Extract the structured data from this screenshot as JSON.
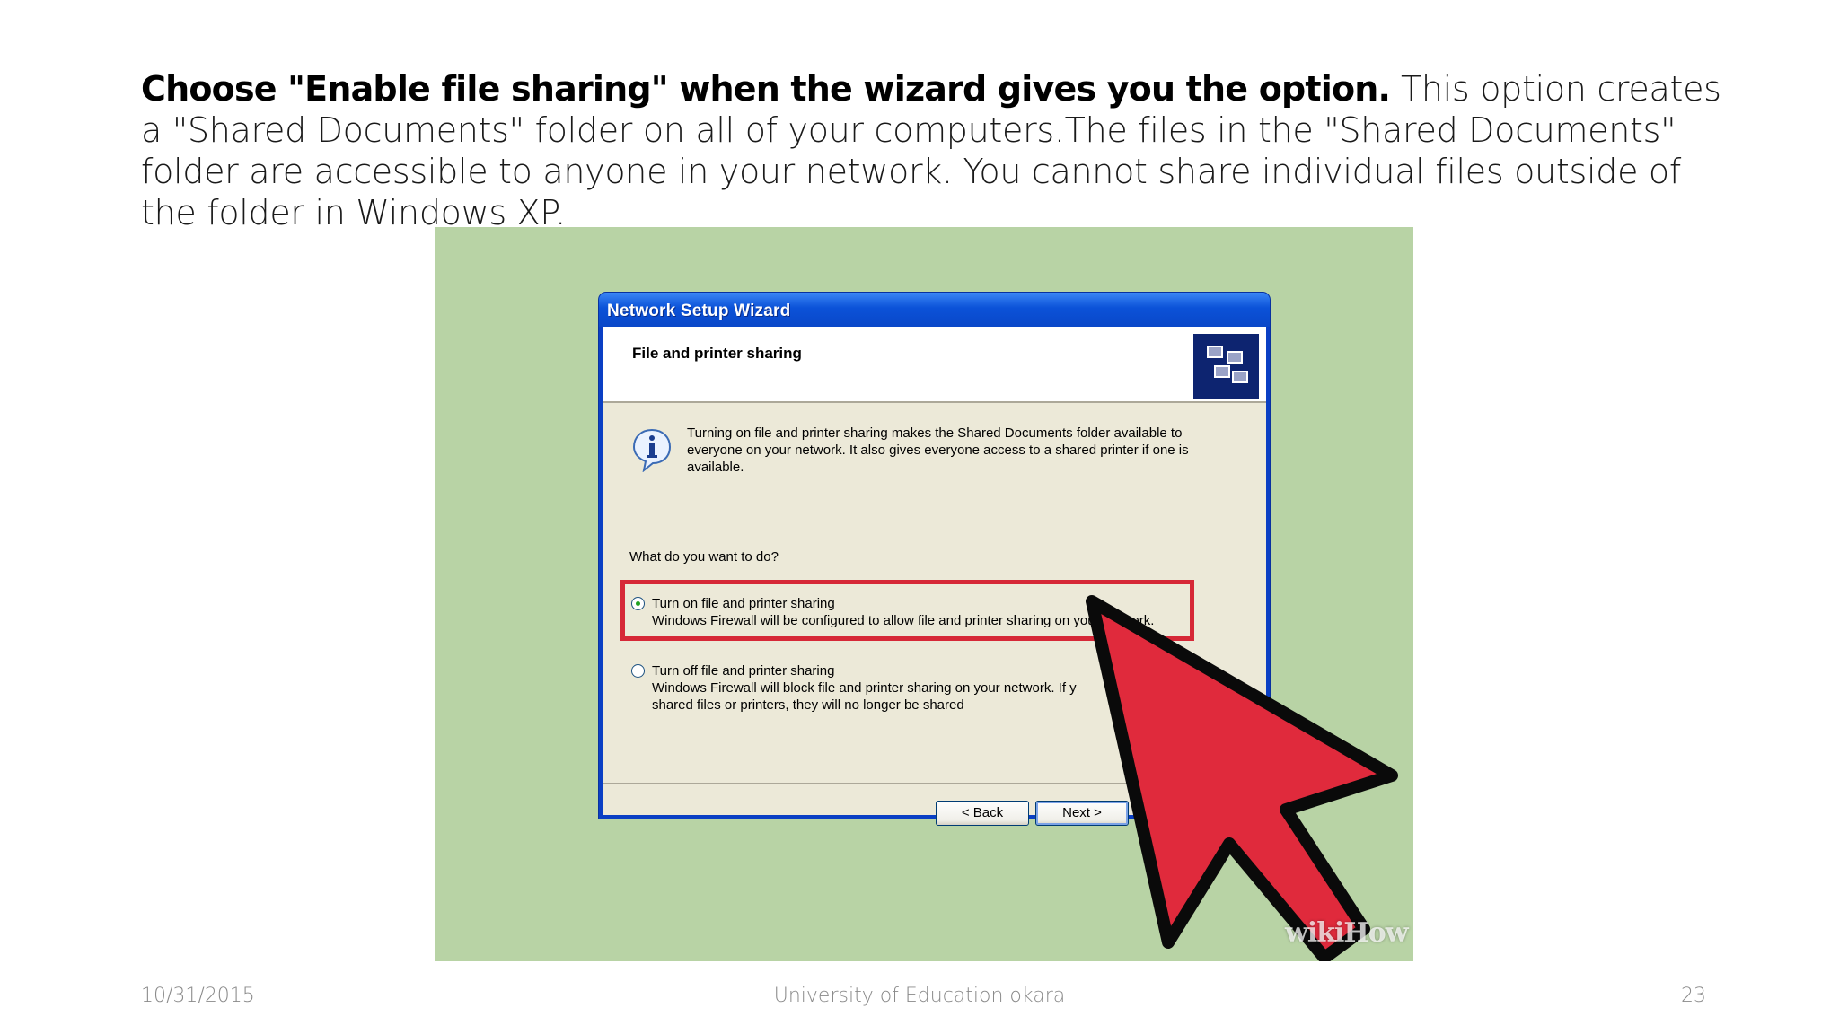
{
  "slide": {
    "heading_bold": "Choose \"Enable file sharing\" when the wizard gives you the option.",
    "heading_rest": " This option creates a \"Shared Documents\" folder on all of your computers.The files in the \"Shared Documents\" folder are accessible to anyone in your network. You cannot share individual files outside of the folder in Windows XP."
  },
  "dialog": {
    "title": "Network Setup Wizard",
    "header_title": "File and printer sharing",
    "description": "Turning on file and printer sharing makes the Shared Documents folder available to everyone on your network. It also gives everyone access to a shared printer if one is available.",
    "question": "What do you want to do?",
    "options": [
      {
        "label": "Turn on file and printer sharing",
        "detail": "Windows Firewall will be configured to allow file and printer sharing on your network.",
        "selected": true
      },
      {
        "label": "Turn off file and printer sharing",
        "detail": "Windows Firewall will block file and printer sharing on your network. If y",
        "detail_2": "shared files or printers, they will no longer be shared",
        "selected": false
      }
    ],
    "back_button": "< Back",
    "next_button": "Next >"
  },
  "watermark": "wikiHow",
  "footer": {
    "date": "10/31/2015",
    "center": "University of Education okara",
    "page": "23"
  },
  "colors": {
    "figure_bg": "#b8d3a5",
    "highlight": "#d62837",
    "cursor": "#e02a3c"
  }
}
